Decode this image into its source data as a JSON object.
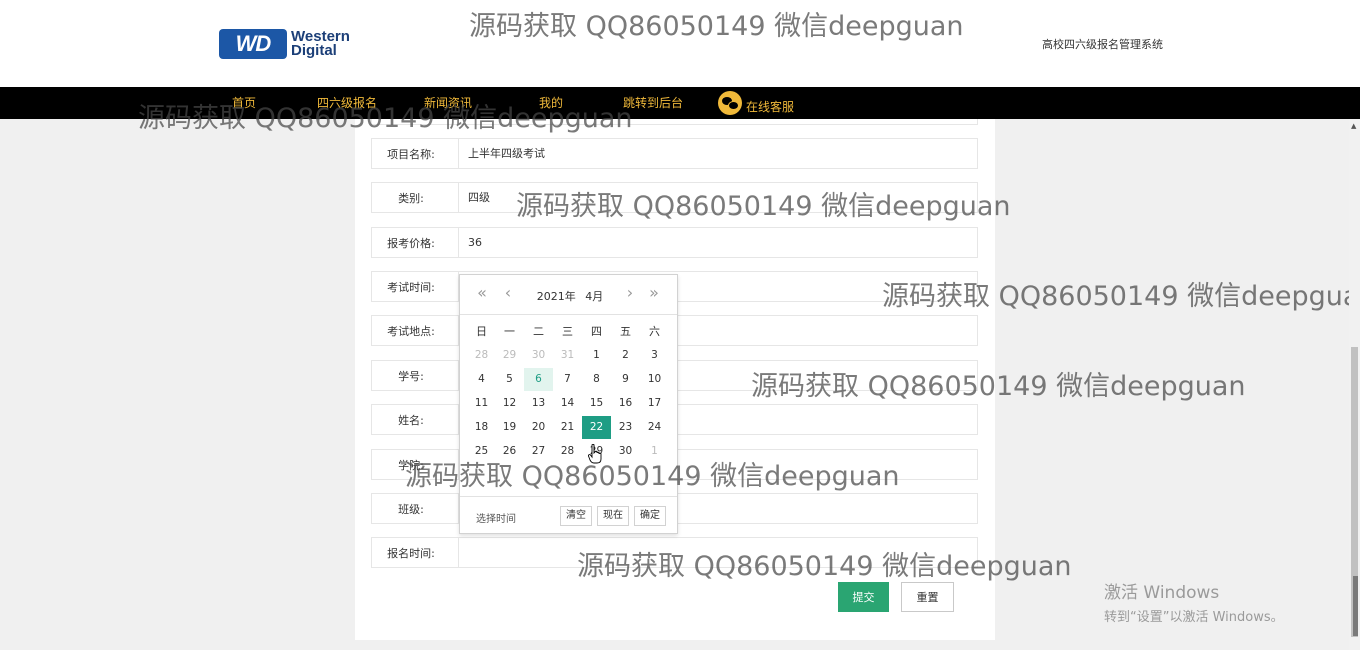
{
  "header": {
    "logo_mark": "WD",
    "logo_line1": "Western",
    "logo_line2": "Digital",
    "site_title": "高校四六级报名管理系统"
  },
  "nav": {
    "items": [
      "首页",
      "四六级报名",
      "新闻资讯",
      "我的",
      "跳转到后台"
    ],
    "service_label": "在线客服"
  },
  "form": {
    "rows": [
      {
        "label": "项目名称:",
        "value": "上半年四级考试"
      },
      {
        "label": "类别:",
        "value": "四级"
      },
      {
        "label": "报考价格:",
        "value": "36"
      },
      {
        "label": "考试时间:",
        "value": ""
      },
      {
        "label": "考试地点:",
        "value": ""
      },
      {
        "label": "学号:",
        "value": ""
      },
      {
        "label": "姓名:",
        "value": ""
      },
      {
        "label": "学院:",
        "value": ""
      },
      {
        "label": "班级:",
        "value": ""
      },
      {
        "label": "报名时间:",
        "value": ""
      }
    ],
    "submit_label": "提交",
    "reset_label": "重置"
  },
  "calendar": {
    "year_label": "2021年",
    "month_label": "4月",
    "weekdays": [
      "日",
      "一",
      "二",
      "三",
      "四",
      "五",
      "六"
    ],
    "days": [
      [
        "28",
        "29",
        "30",
        "31",
        "1",
        "2",
        "3"
      ],
      [
        "4",
        "5",
        "6",
        "7",
        "8",
        "9",
        "10"
      ],
      [
        "11",
        "12",
        "13",
        "14",
        "15",
        "16",
        "17"
      ],
      [
        "18",
        "19",
        "20",
        "21",
        "22",
        "23",
        "24"
      ],
      [
        "25",
        "26",
        "27",
        "28",
        "29",
        "30",
        "1"
      ]
    ],
    "selected_day": "22",
    "marked_day": "6",
    "footer_label": "选择时间",
    "clear_label": "清空",
    "now_label": "现在",
    "confirm_label": "确定"
  },
  "watermark_text": "源码获取 QQ86050149 微信deepguan",
  "windows_activation": {
    "title": "激活 Windows",
    "subtitle": "转到“设置”以激活 Windows。"
  },
  "colors": {
    "nav_background": "#000000",
    "nav_text": "#f0b93a",
    "submit_button": "#2aa572",
    "calendar_selected": "#1e9d84"
  }
}
